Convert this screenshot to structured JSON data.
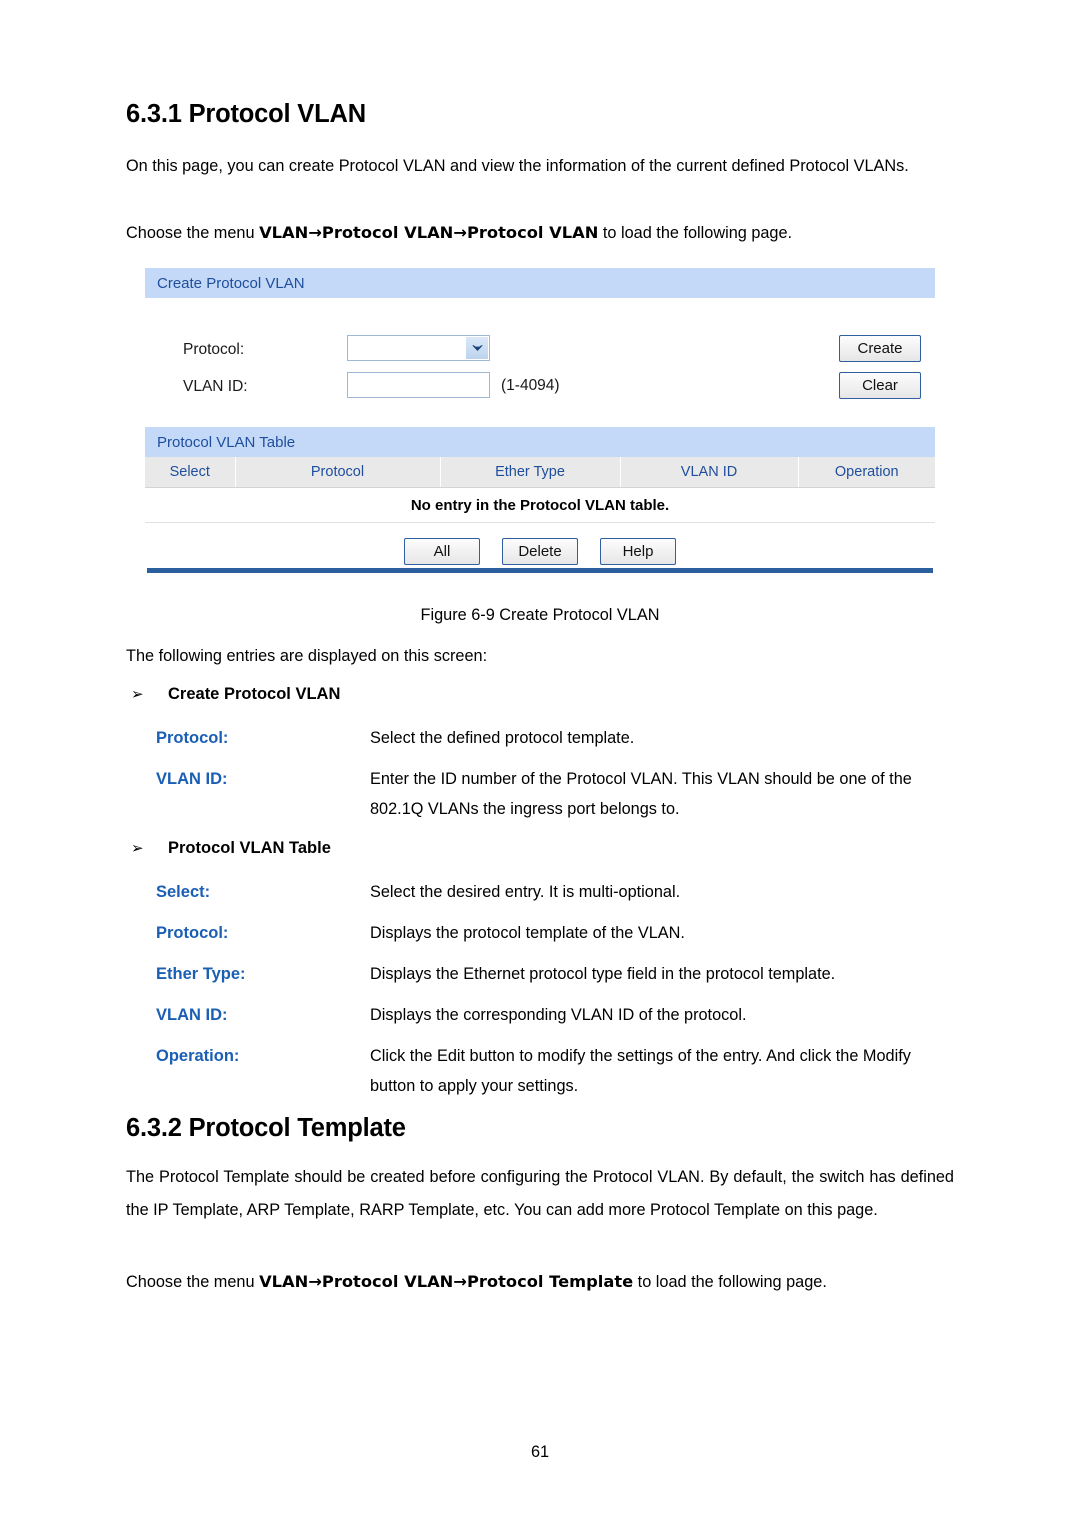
{
  "document": {
    "page_number": "61",
    "heading_631": "6.3.1 Protocol VLAN",
    "para_intro": "On this page, you can create Protocol VLAN and view the information of the current defined Protocol VLANs.",
    "para_choose_1_prefix": "Choose the menu ",
    "para_choose_1_menu": "VLAN→Protocol VLAN→Protocol VLAN",
    "para_choose_1_suffix": " to load the following page.",
    "figure_caption": "Figure 6-9 Create Protocol VLAN",
    "para_following": "The following entries are displayed on this screen:",
    "heading_632": "6.3.2 Protocol Template",
    "para_template_body": "The Protocol Template should be created before configuring the Protocol VLAN. By default, the switch has defined the IP Template, ARP Template, RARP Template, etc. You can add more Protocol Template on this page.",
    "para_choose_2_prefix": "Choose the menu ",
    "para_choose_2_menu": "VLAN→Protocol VLAN→Protocol Template",
    "para_choose_2_suffix": " to load the following page."
  },
  "definitions": {
    "create_group": {
      "bullet": "➢",
      "title": "Create Protocol VLAN",
      "rows": [
        {
          "term": "Protocol:",
          "desc": "Select the defined protocol template."
        },
        {
          "term": "VLAN ID:",
          "desc": "Enter the ID number of the Protocol VLAN. This VLAN should be one of the 802.1Q VLANs the ingress port belongs to."
        }
      ]
    },
    "table_group": {
      "bullet": "➢",
      "title": "Protocol VLAN Table",
      "rows": [
        {
          "term": "Select:",
          "desc": "Select the desired entry. It is multi-optional."
        },
        {
          "term": "Protocol:",
          "desc": "Displays the protocol template of the VLAN."
        },
        {
          "term": "Ether Type:",
          "desc": "Displays the Ethernet protocol type field in the protocol template."
        },
        {
          "term": "VLAN ID:",
          "desc": "Displays the corresponding VLAN ID of the protocol."
        },
        {
          "term": "Operation:",
          "desc": "Click the Edit button to modify the settings of the entry. And click the Modify button to apply your settings."
        }
      ]
    }
  },
  "ui": {
    "create_panel": {
      "title": "Create Protocol VLAN",
      "protocol_label": "Protocol:",
      "protocol_value": "",
      "vlan_id_label": "VLAN ID:",
      "vlan_id_value": "",
      "vlan_id_placeholder": "",
      "vlan_id_range_hint": "(1-4094)",
      "create_button": "Create",
      "clear_button": "Clear"
    },
    "table_panel": {
      "title": "Protocol VLAN Table",
      "columns": [
        "Select",
        "Protocol",
        "Ether Type",
        "VLAN ID",
        "Operation"
      ],
      "empty_message": "No entry in the Protocol VLAN table.",
      "buttons": [
        "All",
        "Delete",
        "Help"
      ]
    },
    "colors": {
      "section_header_bg": "#c3d9f7",
      "section_header_text": "#1f4e9c",
      "column_header_bg": "#e9e9e9",
      "column_header_text": "#1f4e9c",
      "button_border": "#2e5f9e",
      "bottom_rule": "#2b5f9e",
      "definition_term": "#1a5fb4"
    }
  }
}
